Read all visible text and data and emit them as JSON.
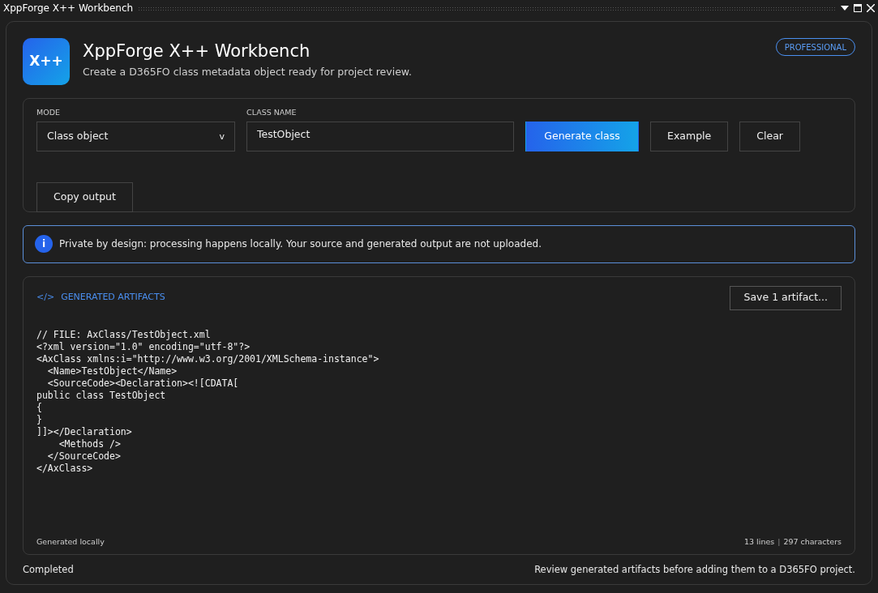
{
  "window": {
    "title": "XppForge X++ Workbench"
  },
  "header": {
    "logo": "X++",
    "title": "XppForge X++ Workbench",
    "subtitle": "Create a D365FO class metadata object ready for project review.",
    "badge": "PROFESSIONAL"
  },
  "form": {
    "mode": {
      "label": "MODE",
      "value": "Class object",
      "caret": "v"
    },
    "class_name": {
      "label": "CLASS NAME",
      "value": "TestObject"
    },
    "buttons": [
      {
        "label": "Generate class",
        "kind": "primary"
      },
      {
        "label": "Example",
        "kind": "outline"
      },
      {
        "label": "Clear",
        "kind": "outline"
      },
      {
        "label": "Copy output",
        "kind": "outline"
      }
    ]
  },
  "notice": {
    "icon": "i",
    "text": "Private by design: processing happens locally. Your source and generated output are not uploaded."
  },
  "artifacts": {
    "icon": "</>",
    "title": "GENERATED ARTIFACTS",
    "save_button": "Save 1 artifact...",
    "code_lines": [
      "// FILE: AxClass/TestObject.xml",
      "<?xml version=\"1.0\" encoding=\"utf-8\"?>",
      "<AxClass xmlns:i=\"http://www.w3.org/2001/XMLSchema-instance\">",
      "  <Name>TestObject</Name>",
      "  <SourceCode><Declaration><![CDATA[",
      "public class TestObject",
      "{",
      "}",
      "]]></Declaration>",
      "    <Methods />",
      "  </SourceCode>",
      "</AxClass>"
    ],
    "footer_left": "Generated locally",
    "line_count": "13 lines",
    "separator": "|",
    "char_count": "297 characters"
  },
  "status_bar": {
    "status": "Completed",
    "hint": "Review generated artifacts before adding them to a D365FO project."
  }
}
